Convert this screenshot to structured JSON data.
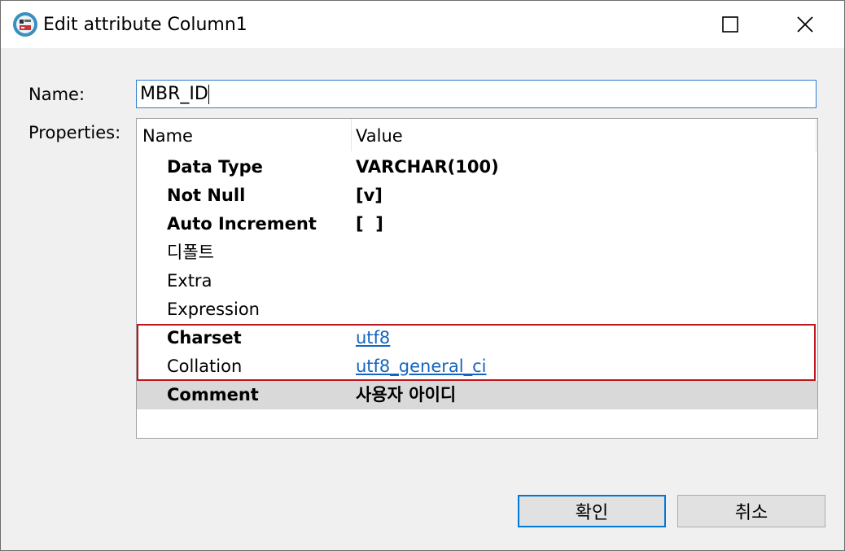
{
  "window": {
    "title": "Edit attribute Column1",
    "icon": "database-app-icon"
  },
  "form": {
    "name_label": "Name:",
    "name_value": "MBR_ID",
    "properties_label": "Properties:"
  },
  "grid": {
    "columns": [
      "Name",
      "Value"
    ],
    "rows": [
      {
        "name": "Data Type",
        "value": "VARCHAR(100)",
        "bold": true
      },
      {
        "name": "Not Null",
        "value": "[v]",
        "bold": true
      },
      {
        "name": "Auto Increment",
        "value": "[  ]",
        "bold": true
      },
      {
        "name": "디폴트",
        "value": "",
        "bold": false
      },
      {
        "name": "Extra",
        "value": "",
        "bold": false
      },
      {
        "name": "Expression",
        "value": "",
        "bold": false
      },
      {
        "name": "Charset",
        "value": "utf8",
        "bold": true,
        "link": true
      },
      {
        "name": "Collation",
        "value": "utf8_general_ci",
        "bold": false,
        "link": true
      },
      {
        "name": "Comment",
        "value": "사용자 아이디",
        "bold": true,
        "selected": true
      }
    ]
  },
  "buttons": {
    "ok": "확인",
    "cancel": "취소"
  },
  "colors": {
    "accent": "#0078d7",
    "highlight": "#c0151f",
    "link": "#1565c0"
  }
}
